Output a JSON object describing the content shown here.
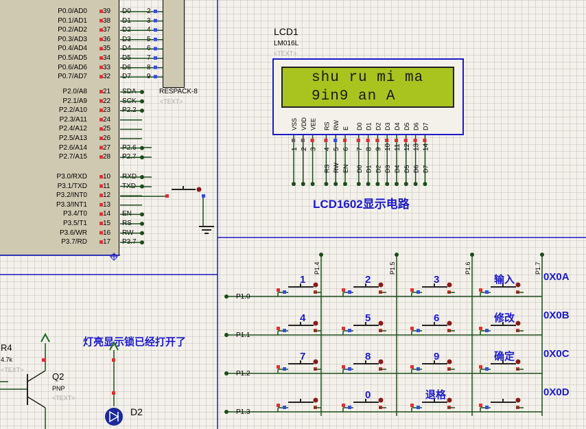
{
  "mcu": {
    "port0": [
      {
        "name": "P0.0/AD0",
        "num": "39",
        "sig": "D0",
        "rnum": "2"
      },
      {
        "name": "P0.1/AD1",
        "num": "38",
        "sig": "D1",
        "rnum": "3"
      },
      {
        "name": "P0.2/AD2",
        "num": "37",
        "sig": "D2",
        "rnum": "4"
      },
      {
        "name": "P0.3/AD3",
        "num": "36",
        "sig": "D3",
        "rnum": "5"
      },
      {
        "name": "P0.4/AD4",
        "num": "35",
        "sig": "D4",
        "rnum": "6"
      },
      {
        "name": "P0.5/AD5",
        "num": "34",
        "sig": "D5",
        "rnum": "7"
      },
      {
        "name": "P0.6/AD6",
        "num": "33",
        "sig": "D6",
        "rnum": "8"
      },
      {
        "name": "P0.7/AD7",
        "num": "32",
        "sig": "D7",
        "rnum": "9"
      }
    ],
    "port2": [
      {
        "name": "P2.0/A8",
        "num": "21",
        "sig": "SDA"
      },
      {
        "name": "P2.1/A9",
        "num": "22",
        "sig": "SCK"
      },
      {
        "name": "P2.2/A10",
        "num": "23",
        "sig": "P2.2"
      },
      {
        "name": "P2.3/A11",
        "num": "24",
        "sig": ""
      },
      {
        "name": "P2.4/A12",
        "num": "25",
        "sig": ""
      },
      {
        "name": "P2.5/A13",
        "num": "26",
        "sig": ""
      },
      {
        "name": "P2.6/A14",
        "num": "27",
        "sig": "P2.6"
      },
      {
        "name": "P2.7/A15",
        "num": "28",
        "sig": "P2.7"
      }
    ],
    "port3": [
      {
        "name": "P3.0/RXD",
        "num": "10",
        "sig": "RXD"
      },
      {
        "name": "P3.1/TXD",
        "num": "11",
        "sig": "TXD"
      },
      {
        "name": "P3.2/INT0",
        "num": "12",
        "sig": ""
      },
      {
        "name": "P3.3/INT1",
        "num": "13",
        "sig": ""
      },
      {
        "name": "P3.4/T0",
        "num": "14",
        "sig": "EN"
      },
      {
        "name": "P3.5/T1",
        "num": "15",
        "sig": "RS"
      },
      {
        "name": "P3.6/WR",
        "num": "16",
        "sig": "RW"
      },
      {
        "name": "P3.7/RD",
        "num": "17",
        "sig": "P3.7"
      }
    ]
  },
  "respack": {
    "name": "RESPACK-8",
    "text": "<TEXT>"
  },
  "lcd": {
    "ref": "LCD1",
    "model": "LM016L",
    "text": "<TEXT>",
    "line1": "shu ru mi ma",
    "line2": "9in9 an A",
    "pins": [
      {
        "name": "VSS",
        "num": "1",
        "bot": ""
      },
      {
        "name": "VDD",
        "num": "2",
        "bot": ""
      },
      {
        "name": "VEE",
        "num": "3",
        "bot": ""
      },
      {
        "name": "RS",
        "num": "4",
        "bot": "RS"
      },
      {
        "name": "RW",
        "num": "5",
        "bot": "RW"
      },
      {
        "name": "E",
        "num": "6",
        "bot": "EN"
      },
      {
        "name": "D0",
        "num": "7",
        "bot": "D0"
      },
      {
        "name": "D1",
        "num": "8",
        "bot": "D1"
      },
      {
        "name": "D2",
        "num": "9",
        "bot": "D2"
      },
      {
        "name": "D3",
        "num": "10",
        "bot": "D3"
      },
      {
        "name": "D4",
        "num": "11",
        "bot": "D4"
      },
      {
        "name": "D5",
        "num": "12",
        "bot": "D5"
      },
      {
        "name": "D6",
        "num": "13",
        "bot": "D6"
      },
      {
        "name": "D7",
        "num": "14",
        "bot": "D7"
      }
    ],
    "caption": "LCD1602显示电路"
  },
  "keypad": {
    "col_labels": [
      "P1.4",
      "P1.5",
      "P1.6",
      "P1.7"
    ],
    "row_labels": [
      "P1.0",
      "P1.1",
      "P1.2",
      "P1.3"
    ],
    "keys": [
      [
        "1",
        "2",
        "3",
        "输入"
      ],
      [
        "4",
        "5",
        "6",
        "修改"
      ],
      [
        "7",
        "8",
        "9",
        "确定"
      ],
      [
        "",
        "0",
        "退格",
        ""
      ]
    ],
    "hex": [
      "0X0A",
      "0X0B",
      "0X0C",
      "0X0D"
    ]
  },
  "led": {
    "caption": "灯亮显示锁已经打开了",
    "r_ref": "R4",
    "r_val": "4.7k",
    "r_text": "<TEXT>",
    "q_ref": "Q2",
    "q_type": "PNP",
    "q_text": "<TEXT>",
    "d_ref": "D2"
  },
  "colors": {
    "wire": "#1a4d1a",
    "border": "#1a1acc",
    "label": "#1a1acc",
    "chip": "#cfc9b2",
    "lcd": "#a9c41f",
    "pin_red": "#e03030",
    "pin_blue": "#3050e0"
  }
}
